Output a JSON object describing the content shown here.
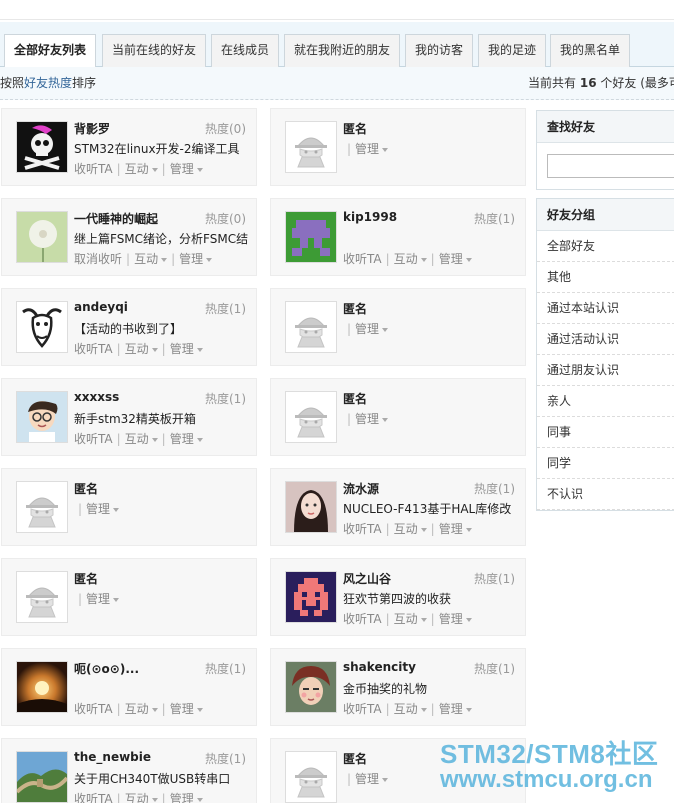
{
  "tabs": [
    {
      "label": "全部好友列表",
      "active": true
    },
    {
      "label": "当前在线的好友",
      "active": false
    },
    {
      "label": "在线成员",
      "active": false
    },
    {
      "label": "就在我附近的朋友",
      "active": false
    },
    {
      "label": "我的访客",
      "active": false
    },
    {
      "label": "我的足迹",
      "active": false
    },
    {
      "label": "我的黑名单",
      "active": false
    }
  ],
  "sort": {
    "prefix": "按照",
    "key": "好友热度",
    "suffix": "排序"
  },
  "count": {
    "prefix": "当前共有",
    "number": "16",
    "suffix": "个好友 (最多可"
  },
  "friends": [
    {
      "name": "背影罗",
      "heat": "热度(0)",
      "status": "STM32在linux开发-2编译工具",
      "follow": "收听TA",
      "interact": "互动",
      "manage": "管理",
      "avatar": "pirate-skull",
      "anon": false
    },
    {
      "name": "匿名",
      "heat": "",
      "status": "",
      "follow": "",
      "interact": "",
      "manage": "管理",
      "avatar": "anonymous",
      "anon": true
    },
    {
      "name": "一代睡神的崛起",
      "heat": "热度(0)",
      "status": "继上篇FSMC绪论，分析FSMC结",
      "follow": "取消收听",
      "interact": "互动",
      "manage": "管理",
      "avatar": "dandelion",
      "anon": false
    },
    {
      "name": "kip1998",
      "heat": "热度(1)",
      "status": "",
      "follow": "收听TA",
      "interact": "互动",
      "manage": "管理",
      "avatar": "pixel-green",
      "anon": false
    },
    {
      "name": "andeyqi",
      "heat": "热度(1)",
      "status": "【活动的书收到了】",
      "follow": "收听TA",
      "interact": "互动",
      "manage": "管理",
      "avatar": "gnu",
      "anon": false
    },
    {
      "name": "匿名",
      "heat": "",
      "status": "",
      "follow": "",
      "interact": "",
      "manage": "管理",
      "avatar": "anonymous",
      "anon": true
    },
    {
      "name": "xxxxss",
      "heat": "热度(1)",
      "status": "新手stm32精英板开箱",
      "follow": "收听TA",
      "interact": "互动",
      "manage": "管理",
      "avatar": "cartoon-boy",
      "anon": false
    },
    {
      "name": "匿名",
      "heat": "",
      "status": "",
      "follow": "",
      "interact": "",
      "manage": "管理",
      "avatar": "anonymous",
      "anon": true
    },
    {
      "name": "匿名",
      "heat": "",
      "status": "",
      "follow": "",
      "interact": "",
      "manage": "管理",
      "avatar": "anonymous",
      "anon": true
    },
    {
      "name": "流水源",
      "heat": "热度(1)",
      "status": "NUCLEO-F413基于HAL库修改",
      "follow": "收听TA",
      "interact": "互动",
      "manage": "管理",
      "avatar": "girl",
      "anon": false
    },
    {
      "name": "匿名",
      "heat": "",
      "status": "",
      "follow": "",
      "interact": "",
      "manage": "管理",
      "avatar": "anonymous",
      "anon": true
    },
    {
      "name": "风之山谷",
      "heat": "热度(1)",
      "status": "狂欢节第四波的收获",
      "follow": "收听TA",
      "interact": "互动",
      "manage": "管理",
      "avatar": "pixel-invader",
      "anon": false
    },
    {
      "name": "呃(⊙o⊙)...",
      "heat": "热度(1)",
      "status": "",
      "follow": "收听TA",
      "interact": "互动",
      "manage": "管理",
      "avatar": "sunset",
      "anon": false
    },
    {
      "name": "shakencity",
      "heat": "热度(1)",
      "status": "金币抽奖的礼物",
      "follow": "收听TA",
      "interact": "互动",
      "manage": "管理",
      "avatar": "anime",
      "anon": false
    },
    {
      "name": "the_newbie",
      "heat": "热度(1)",
      "status": "关于用CH340T做USB转串口",
      "follow": "收听TA",
      "interact": "互动",
      "manage": "管理",
      "avatar": "great-wall",
      "anon": false
    },
    {
      "name": "匿名",
      "heat": "",
      "status": "",
      "follow": "",
      "interact": "",
      "manage": "管理",
      "avatar": "anonymous",
      "anon": true
    }
  ],
  "sidebar": {
    "search_title": "查找好友",
    "group_title": "好友分组",
    "groups": [
      "全部好友",
      "其他",
      "通过本站认识",
      "通过活动认识",
      "通过朋友认识",
      "亲人",
      "同事",
      "同学",
      "不认识"
    ]
  },
  "watermark": {
    "line1": "STM32/STM8社区",
    "line2": "www.stmcu.org.cn"
  }
}
